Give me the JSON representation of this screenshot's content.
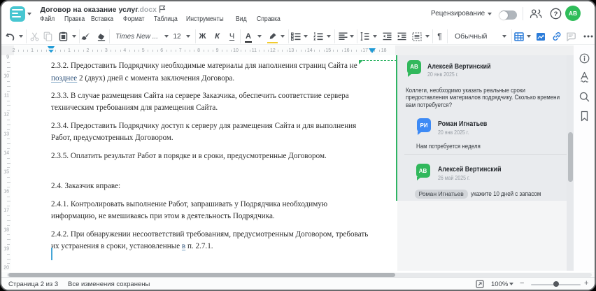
{
  "header": {
    "title": "Договор на оказание услуг",
    "extension": ".docx",
    "review_label": "Рецензирование",
    "avatar_initials": "АВ"
  },
  "menu": {
    "items": [
      {
        "label": "Файл"
      },
      {
        "label": "Правка"
      },
      {
        "label": "Вставка"
      },
      {
        "label": "Формат"
      },
      {
        "label": "Таблица"
      },
      {
        "label": "Инструменты"
      },
      {
        "label": "Вид"
      },
      {
        "label": "Справка"
      }
    ]
  },
  "toolbar": {
    "font_name": "Times New ...",
    "font_size": "12",
    "bold_label": "Ж",
    "italic_label": "К",
    "underline_label": "Ч",
    "font_color_label": "А",
    "pilcrow": "¶",
    "style_name": "Обычный"
  },
  "ruler": {
    "h_left_numbers": [
      "2",
      "1"
    ],
    "h_numbers": [
      "1",
      "2",
      "3",
      "4",
      "5",
      "6",
      "7",
      "8",
      "9",
      "10",
      "11",
      "12",
      "13",
      "14",
      "15",
      "16",
      "17",
      "18"
    ],
    "v_numbers": [
      "9",
      "10",
      "11",
      "12",
      "13",
      "14",
      "15",
      "16",
      "17",
      "18",
      "19",
      "20"
    ]
  },
  "document": {
    "l1": "2.3.2. Предоставить Подрядчику необходимые материалы для наполнения страниц Сайта не",
    "l2_ins": "позднее",
    "l2_rest": " 2 (двух) дней с момента заключения Договора.",
    "l3": "2.3.3. В случае размещения Сайта на сервере Заказчика, обеспечить соответствие сервера",
    "l4": "техническим требованиям для размещения Сайта.",
    "l5": "2.3.4. Предоставить Подрядчику доступ к серверу для размещения Сайта и для выполнения",
    "l6": "Работ, предусмотренных Договором.",
    "l7": "2.3.5. Оплатить результат Работ в порядке и в сроки, предусмотренные Договором.",
    "l8": "2.4. Заказчик вправе:",
    "l9": "2.4.1. Контролировать выполнение Работ, запрашивать у Подрядчика необходимую",
    "l10": "информацию, не вмешиваясь при этом в деятельность Подрядчика.",
    "l11": "2.4.2. При обнаружении несоответствий требованиям, предусмотренным Договором, требовать",
    "l12_pre": "их устранения в сроки, установленные ",
    "l12_ins": "в",
    "l12_post": " п. 2.7.1."
  },
  "comments": {
    "thread": [
      {
        "initials": "АВ",
        "name": "Алексей Вертинский",
        "date": "20 янв 2025 г.",
        "line1": "Коллеги, необходимо указать реальные сроки",
        "line2": "предоставления материалов подрядчику. Сколько времени",
        "line3": "вам потребуется?"
      },
      {
        "initials": "РИ",
        "name": "Роман Игнатьев",
        "date": "20 янв 2025 г.",
        "text": "Нам потребуется неделя"
      },
      {
        "initials": "АВ",
        "name": "Алексей Вертинский",
        "date": "26 май 2025 г.",
        "mention": "Роман Игнатьев",
        "text": "укажите 10 дней с запасом"
      }
    ]
  },
  "statusbar": {
    "page_info": "Страница 2 из 3",
    "saved_info": "Все изменения сохранены",
    "zoom_value": "100%",
    "zoom_minus": "−",
    "zoom_plus": "+"
  }
}
